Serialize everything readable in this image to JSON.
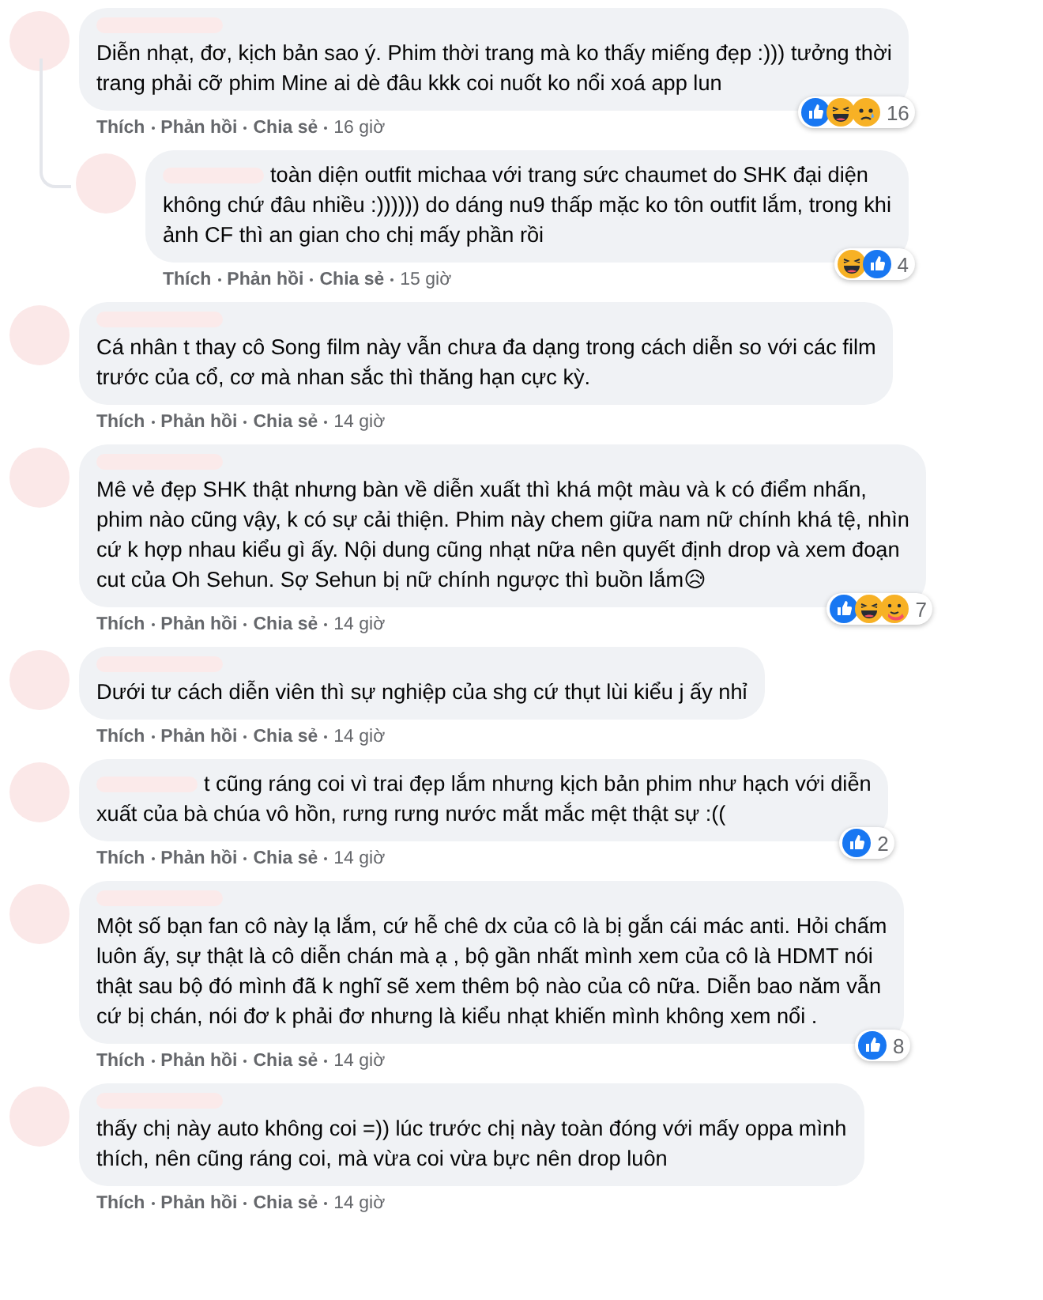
{
  "comments": [
    {
      "kind": "name-above",
      "lines": [
        "Diễn nhạt, đơ, kịch bản sao ý. Phim thời trang mà ko thấy miếng đẹp :))) tưởng thời",
        "trang phải cỡ phim Mine ai dè đâu kkk coi nuốt ko nổi xoá app lun"
      ],
      "actions": [
        "Thích",
        "Phản hồi",
        "Chia sẻ"
      ],
      "time": "16 giờ",
      "reactions": {
        "items": [
          {
            "kind": "like"
          },
          {
            "kind": "haha"
          },
          {
            "kind": "sad"
          }
        ],
        "count": "16"
      },
      "children": [
        {
          "kind": "name-inline",
          "lines": [
            "toàn diện outfit michaa với trang sức chaumet do SHK đại diện",
            "không chứ đâu nhiều :)))))) do dáng nu9 thấp mặc ko tôn outfit lắm, trong khi",
            "ảnh CF thì an gian cho chị mấy phần rồi"
          ],
          "actions": [
            "Thích",
            "Phản hồi",
            "Chia sẻ"
          ],
          "time": "15 giờ",
          "reactions": {
            "items": [
              {
                "kind": "haha"
              },
              {
                "kind": "like"
              }
            ],
            "count": "4"
          }
        }
      ]
    },
    {
      "kind": "name-above",
      "lines": [
        "Cá nhân t thay cô Song film này vẫn chưa đa dạng trong cách diễn so với các film",
        "trước của cổ, cơ mà nhan sắc thì thăng hạn cực kỳ."
      ],
      "actions": [
        "Thích",
        "Phản hồi",
        "Chia sẻ"
      ],
      "time": "14 giờ"
    },
    {
      "kind": "name-above",
      "lines": [
        "Mê vẻ đẹp SHK thật nhưng bàn về diễn xuất thì khá một màu và k có điểm nhấn,",
        "phim nào cũng vậy, k có sự cải thiện. Phim này chem giữa nam nữ chính khá tệ, nhìn",
        "cứ k hợp nhau kiểu gì ấy. Nội dung cũng nhạt nữa nên quyết định drop và xem đoạn",
        "cut của Oh Sehun. Sợ Sehun bị nữ chính ngược thì buồn lắm😥"
      ],
      "actions": [
        "Thích",
        "Phản hồi",
        "Chia sẻ"
      ],
      "time": "14 giờ",
      "reactions": {
        "items": [
          {
            "kind": "like"
          },
          {
            "kind": "haha"
          },
          {
            "kind": "care"
          }
        ],
        "count": "7"
      }
    },
    {
      "kind": "name-above",
      "lines": [
        "Dưới tư cách diễn viên thì sự nghiệp của shg cứ thụt lùi kiểu j ấy nhỉ"
      ],
      "actions": [
        "Thích",
        "Phản hồi",
        "Chia sẻ"
      ],
      "time": "14 giờ"
    },
    {
      "kind": "name-inline",
      "lines": [
        "t cũng ráng coi vì trai đẹp lắm nhưng kịch bản phim như hạch với diễn",
        "xuất của bà chúa vô hồn, rưng rưng nước mắt mắc mệt thật sự :(("
      ],
      "actions": [
        "Thích",
        "Phản hồi",
        "Chia sẻ"
      ],
      "time": "14 giờ",
      "reactions": {
        "items": [
          {
            "kind": "like"
          }
        ],
        "count": "2"
      }
    },
    {
      "kind": "name-above",
      "lines": [
        "Một số bạn fan cô này lạ lắm, cứ hễ chê dx của cô là bị gắn cái mác anti. Hỏi chấm",
        "luôn ấy, sự thật là cô diễn chán mà ạ , bộ gần nhất mình xem của cô là HDMT nói",
        "thật sau bộ đó mình đã k nghĩ sẽ xem thêm bộ nào của cô nữa. Diễn bao năm vẫn",
        "cứ bị chán, nói đơ k phải đơ nhưng là kiểu nhạt khiến mình không xem nổi ."
      ],
      "actions": [
        "Thích",
        "Phản hồi",
        "Chia sẻ"
      ],
      "time": "14 giờ",
      "reactions": {
        "items": [
          {
            "kind": "like"
          }
        ],
        "count": "8"
      }
    },
    {
      "kind": "name-above",
      "lines": [
        "thấy chị này auto không coi =)) lúc trước chị này toàn đóng với mấy oppa mình",
        "thích, nên cũng ráng coi, mà vừa coi vừa bực nên drop luôn"
      ],
      "actions": [
        "Thích",
        "Phản hồi",
        "Chia sẻ"
      ],
      "time": "14 giờ"
    }
  ]
}
